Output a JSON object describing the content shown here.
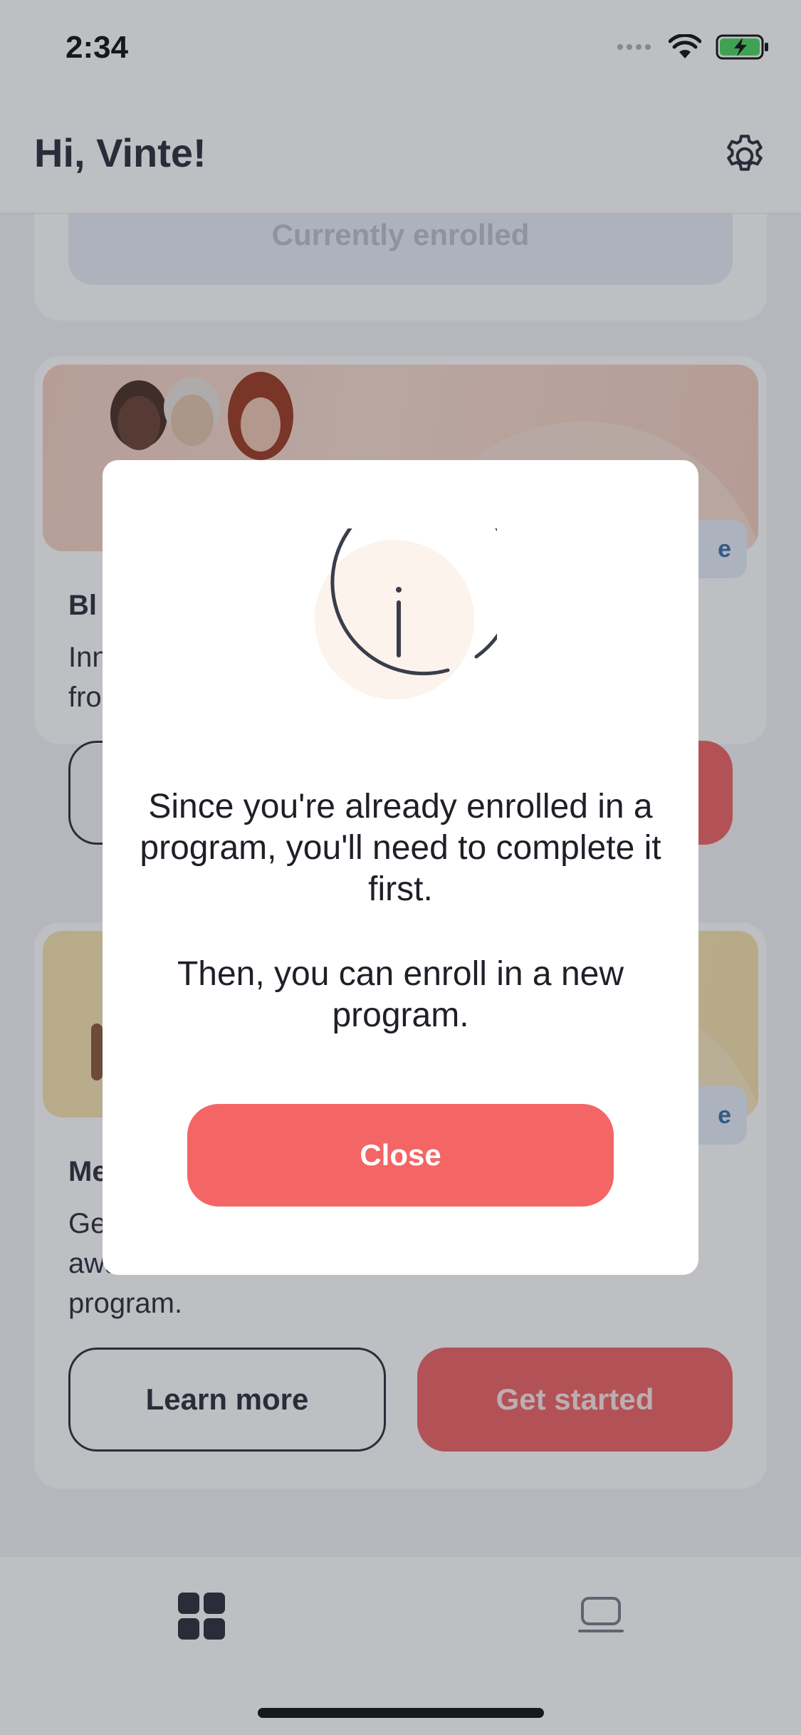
{
  "status_bar": {
    "time": "2:34"
  },
  "header": {
    "greeting": "Hi, Vinte!"
  },
  "card_enrolled": {
    "button_label": "Currently enrolled"
  },
  "card_bloom": {
    "title": "Bl",
    "description_line1": "Inn",
    "description_line2": "fro",
    "badge": "e"
  },
  "card_me": {
    "title": "Me",
    "description_line1": "Ge",
    "description_line2": "awa",
    "description_line3": "program.",
    "badge": "e",
    "learn_more_label": "Learn more",
    "get_started_label": "Get started"
  },
  "modal": {
    "message_1": "Since you're already enrolled in a program, you'll need to complete it first.",
    "message_2": "Then, you can enroll in a new program.",
    "close_label": "Close"
  },
  "colors": {
    "accent": "#f46565",
    "text": "#2b2d3a",
    "icon_fill": "#fbf3ec"
  }
}
